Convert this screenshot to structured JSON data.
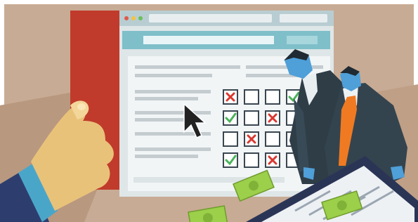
{
  "illustration": {
    "checklist": {
      "rows": [
        [
          "cross",
          "empty",
          "empty",
          "check"
        ],
        [
          "check",
          "empty",
          "cross",
          "empty"
        ],
        [
          "empty",
          "cross",
          "empty",
          "empty"
        ],
        [
          "check",
          "empty",
          "cross",
          "empty"
        ]
      ]
    },
    "colors": {
      "background": "#c8ab94",
      "clipboard_red": "#c03b2b",
      "browser_header_teal": "#7fbfc9",
      "browser_body": "#f2f5f6",
      "check_green": "#4bb35a",
      "cross_red": "#d9382f",
      "suit_dark": "#34444f",
      "tie_orange": "#f07a22",
      "skin_blue": "#4f9fd8",
      "hand_skin": "#e9c27a",
      "money_green": "#9ccf4a"
    },
    "icons": [
      "cursor-arrow-icon",
      "check-icon",
      "cross-icon",
      "banknote-icon"
    ]
  }
}
